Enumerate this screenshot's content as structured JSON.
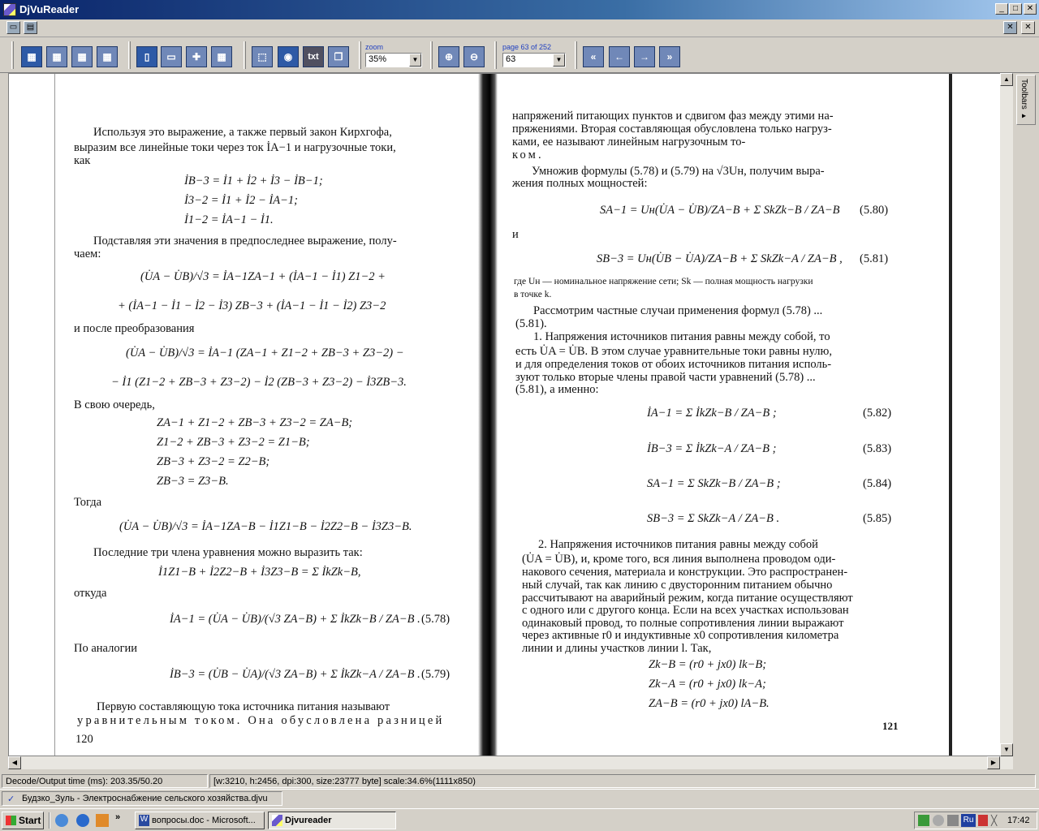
{
  "window": {
    "title": "DjVuReader",
    "min": "_",
    "max": "□",
    "close": "✕"
  },
  "toolbar": {
    "zoom_label": "zoom",
    "zoom_value": "35%",
    "page_label": "page 63 of 252",
    "page_value": "63",
    "txt_label": "txt"
  },
  "sidebar": {
    "tab_label": "Toolbars ▸"
  },
  "status": {
    "timing": "Decode/Output time (ms): 203.35/50.20",
    "info": "[w:3210, h:2456, dpi:300, size:23777 byte] scale:34.6%(1111x850)"
  },
  "document": {
    "file_name": "Будзко_Зуль - Электроснабжение сельского хозяйства.djvu"
  },
  "left_page": {
    "lines": [
      "Используя это выражение, а также первый закон Кирхгофа,",
      "выразим все линейные токи через ток İA−1 и нагрузочные токи,",
      "как",
      "Подставляя эти значения в предпоследнее выражение, полу-",
      "чаем:",
      "и после преобразования",
      "В свою очередь,",
      "Тогда",
      "Последние три члена уравнения можно выразить так:",
      "откуда",
      "По аналогии",
      "Первую составляющую тока источника питания называют",
      "уравнительным током. Она обусловлена разницей"
    ],
    "formulas": [
      "İB−3 = İ1 + İ2 + İ3 − İB−1;",
      "İ3−2 = İ1 + İ2 − İA−1;",
      "İ1−2 = İA−1 − İ1.",
      "(U̇A − U̇B)/√3 = İA−1ZA−1 + (İA−1 − İ1) Z1−2 +",
      "+ (İA−1 − İ1 − İ2 − İ3) ZB−3 + (İA−1 − İ1 − İ2) Z3−2",
      "(U̇A − U̇B)/√3 = İA−1 (ZA−1 + Z1−2 + ZB−3 + Z3−2) −",
      "− İ1 (Z1−2 + ZB−3 + Z3−2) − İ2 (ZB−3 + Z3−2) − İ3ZB−3.",
      "ZA−1 + Z1−2 + ZB−3 + Z3−2 = ZA−B;",
      "Z1−2 + ZB−3 + Z3−2 = Z1−B;",
      "ZB−3 + Z3−2 = Z2−B;",
      "ZB−3 = Z3−B.",
      "(U̇A − U̇B)/√3 = İA−1ZA−B − İ1Z1−B − İ2Z2−B − İ3Z3−B.",
      "İ1Z1−B + İ2Z2−B + İ3Z3−B = Σ İkZk−B,",
      "İA−1 = (U̇A − U̇B)/(√3 ZA−B) + Σ İkZk−B / ZA−B .",
      "İB−3 = (U̇B − U̇A)/(√3 ZA−B) + Σ İkZk−A / ZA−B ."
    ],
    "eq_numbers": [
      "(5.78)",
      "(5.79)"
    ],
    "page_number": "120"
  },
  "right_page": {
    "lines": [
      "напряжений питающих пунктов и сдвигом фаз между этими на-",
      "пряжениями. Вторая составляющая обусловлена только нагруз-",
      "ками, ее называют линейным нагрузочным то-",
      "ком.",
      "Умножив формулы (5.78) и (5.79) на √3Uн, получим выра-",
      "жения полных мощностей:",
      "и",
      "где Uн — номинальное напряжение сети; Sk — полная мощность нагрузки",
      "в точке k.",
      "Рассмотрим частные случаи применения формул (5.78) ...",
      "(5.81).",
      "1. Напряжения источников питания равны между собой, то",
      "есть U̇A = U̇B. В этом случае уравнительные токи равны нулю,",
      "и для определения токов от обоих источников питания исполь-",
      "зуют только вторые члены правой части уравнений (5.78) ...",
      "(5.81), а именно:",
      "2. Напряжения источников питания равны между собой",
      "(U̇A = U̇B), и, кроме того, вся линия выполнена проводом оди-",
      "накового сечения, материала и конструкции. Это распространен-",
      "ный случай, так как линию с двусторонним питанием обычно",
      "рассчитывают на аварийный режим, когда питание осуществляют",
      "с одного или с другого конца. Если на всех участках использован",
      "одинаковый провод, то полные сопротивления линии выражают",
      "через активные r0 и индуктивные x0 сопротивления километра",
      "линии и длины участков линии l. Так,"
    ],
    "formulas": [
      "SA−1 = Uн(U̇A − U̇B)/ZA−B + Σ SkZk−B / ZA−B",
      "SB−3 = Uн(U̇B − U̇A)/ZA−B + Σ SkZk−A / ZA−B ,",
      "İA−1 = Σ İkZk−B / ZA−B ;",
      "İB−3 = Σ İkZk−A / ZA−B ;",
      "SA−1 = Σ SkZk−B / ZA−B ;",
      "SB−3 = Σ SkZk−A / ZA−B .",
      "Zk−B = (r0 + jx0) lk−B;",
      "Zk−A = (r0 + jx0) lk−A;",
      "ZA−B = (r0 + jx0) lA−B."
    ],
    "eq_numbers": [
      "(5.80)",
      "(5.81)",
      "(5.82)",
      "(5.83)",
      "(5.84)",
      "(5.85)"
    ],
    "page_number": "121"
  },
  "taskbar": {
    "start_label": "Start",
    "tasks": [
      "вопросы.doc - Microsoft...",
      "Djvureader"
    ],
    "tray_lang": "Ru",
    "clock": "17:42",
    "chevron": "»"
  }
}
